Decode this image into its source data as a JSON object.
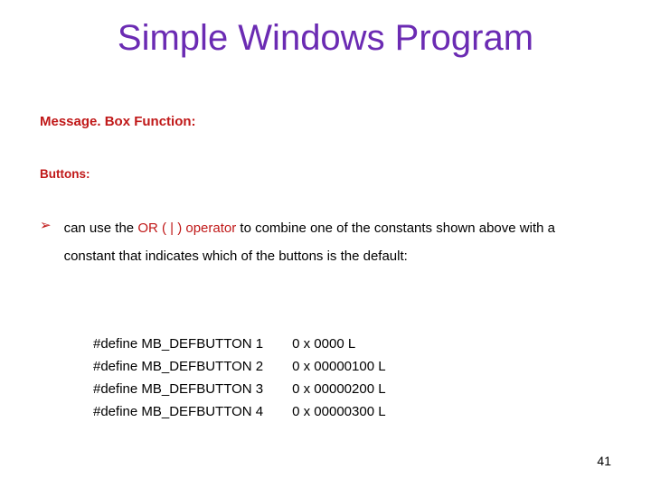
{
  "title": "Simple Windows Program",
  "subhead1": "Message. Box Function:",
  "subhead2": "Buttons:",
  "bullet": {
    "marker": "➢",
    "pre": "can use the ",
    "highlight": "OR ( | ) operator",
    "post": " to combine one of the constants shown above with a constant that indicates which of the buttons is the default:"
  },
  "defines": [
    {
      "name": "#define MB_DEFBUTTON 1",
      "value": "0 x 0000 L"
    },
    {
      "name": "#define MB_DEFBUTTON 2",
      "value": "0 x 00000100 L"
    },
    {
      "name": "#define MB_DEFBUTTON 3",
      "value": "0 x 00000200 L"
    },
    {
      "name": "#define MB_DEFBUTTON 4",
      "value": "0 x 00000300 L"
    }
  ],
  "page_number": "41"
}
